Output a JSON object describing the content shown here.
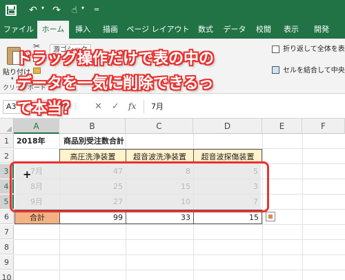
{
  "colors": {
    "brand": "#217346",
    "accent_red": "#e8322f",
    "header_fill": "#fff2cc",
    "total_fill": "#f4b183"
  },
  "titlebar": {
    "icons": [
      "save-icon",
      "undo-icon",
      "redo-icon",
      "touch-mode-icon",
      "customize-icon"
    ]
  },
  "tabs": [
    {
      "label": "ファイル",
      "active": false
    },
    {
      "label": "ホーム",
      "active": true
    },
    {
      "label": "挿入",
      "active": false
    },
    {
      "label": "描画",
      "active": false
    },
    {
      "label": "ページ レイアウト",
      "active": false
    },
    {
      "label": "数式",
      "active": false
    },
    {
      "label": "データ",
      "active": false
    },
    {
      "label": "校閲",
      "active": false
    },
    {
      "label": "表示",
      "active": false
    },
    {
      "label": "開発",
      "active": false
    }
  ],
  "ribbon": {
    "paste_label": "貼り付け",
    "font_name": "游ゴシック",
    "clipboard_group": "クリップボード",
    "wrap_text": "折り返して全体を表",
    "merge_center": "セルを結合して中央揃"
  },
  "formula_bar": {
    "name_box": "A3",
    "cancel": "✕",
    "enter": "✓",
    "fx": "fx",
    "value": "7月"
  },
  "grid": {
    "columns": [
      "A",
      "B",
      "C",
      "D",
      "E",
      "F"
    ],
    "selected_column": "A",
    "rows": [
      "1",
      "2",
      "3",
      "4",
      "5",
      "6",
      "7",
      "8",
      "9",
      "10"
    ],
    "selected_rows": [
      "3",
      "4",
      "5"
    ],
    "title_year": "2018年",
    "title_text": "商品別受注数合計",
    "headers": [
      "高圧洗浄装置",
      "超音波洗浄装置",
      "超音波探傷装置"
    ],
    "data_rows": [
      {
        "label": "7月",
        "values": [
          "47",
          "8",
          "5"
        ]
      },
      {
        "label": "8月",
        "values": [
          "25",
          "15",
          "3"
        ]
      },
      {
        "label": "9月",
        "values": [
          "27",
          "10",
          "7"
        ]
      }
    ],
    "total_label": "合計",
    "totals": [
      "99",
      "33",
      "15"
    ]
  },
  "overlay": {
    "lines": [
      "ドラッグ操作だけで表の中の",
      "データを一気に削除できるっ",
      "て本当？"
    ]
  }
}
